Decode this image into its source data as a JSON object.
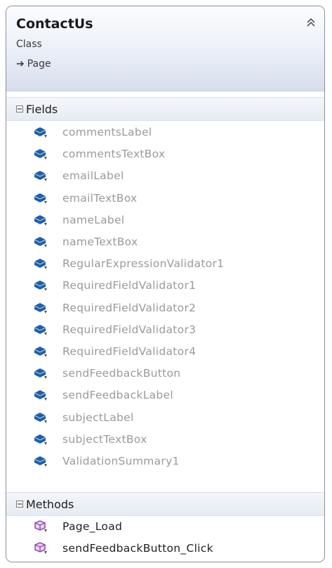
{
  "class": {
    "name": "ContactUs",
    "stereotype": "Class",
    "base_arrow": "➔",
    "base": "Page"
  },
  "sections": {
    "fields_label": "Fields",
    "methods_label": "Methods"
  },
  "fields": [
    "commentsLabel",
    "commentsTextBox",
    "emailLabel",
    "emailTextBox",
    "nameLabel",
    "nameTextBox",
    "RegularExpressionValidator1",
    "RequiredFieldValidator1",
    "RequiredFieldValidator2",
    "RequiredFieldValidator3",
    "RequiredFieldValidator4",
    "sendFeedbackButton",
    "sendFeedbackLabel",
    "subjectLabel",
    "subjectTextBox",
    "ValidationSummary1"
  ],
  "methods": [
    "Page_Load",
    "sendFeedbackButton_Click"
  ],
  "icons": {
    "field": "protected-field-icon",
    "method": "protected-method-icon",
    "collapse": "double-chevron-up-icon",
    "section_toggle": "collapse-minus-icon"
  },
  "colors": {
    "field_icon": "#1f5fa8",
    "method_icon": "#8c3aa8",
    "header_gradient_end": "#d6deec"
  }
}
